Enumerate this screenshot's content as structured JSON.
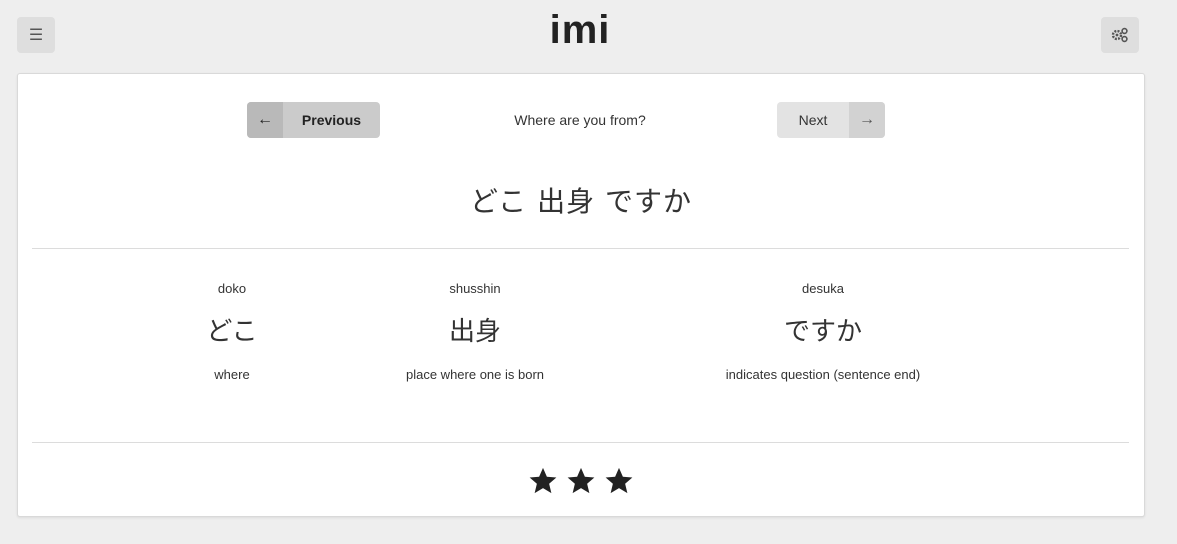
{
  "header": {
    "title": "imi",
    "menu_icon": "hamburger-icon",
    "settings_icon": "gears-icon"
  },
  "nav": {
    "previous_label": "Previous",
    "next_label": "Next",
    "question": "Where are you from?"
  },
  "sentence": "どこ 出身 ですか",
  "words": [
    {
      "romaji": "doko",
      "kana": "どこ",
      "meaning": "where"
    },
    {
      "romaji": "shusshin",
      "kana": "出身",
      "meaning": "place where one is born"
    },
    {
      "romaji": "desuka",
      "kana": "ですか",
      "meaning": "indicates question (sentence end)"
    }
  ],
  "rating": {
    "stars": 3,
    "max": 3
  },
  "colors": {
    "background": "#eeeeee",
    "card": "#ffffff",
    "star": "#222222"
  }
}
